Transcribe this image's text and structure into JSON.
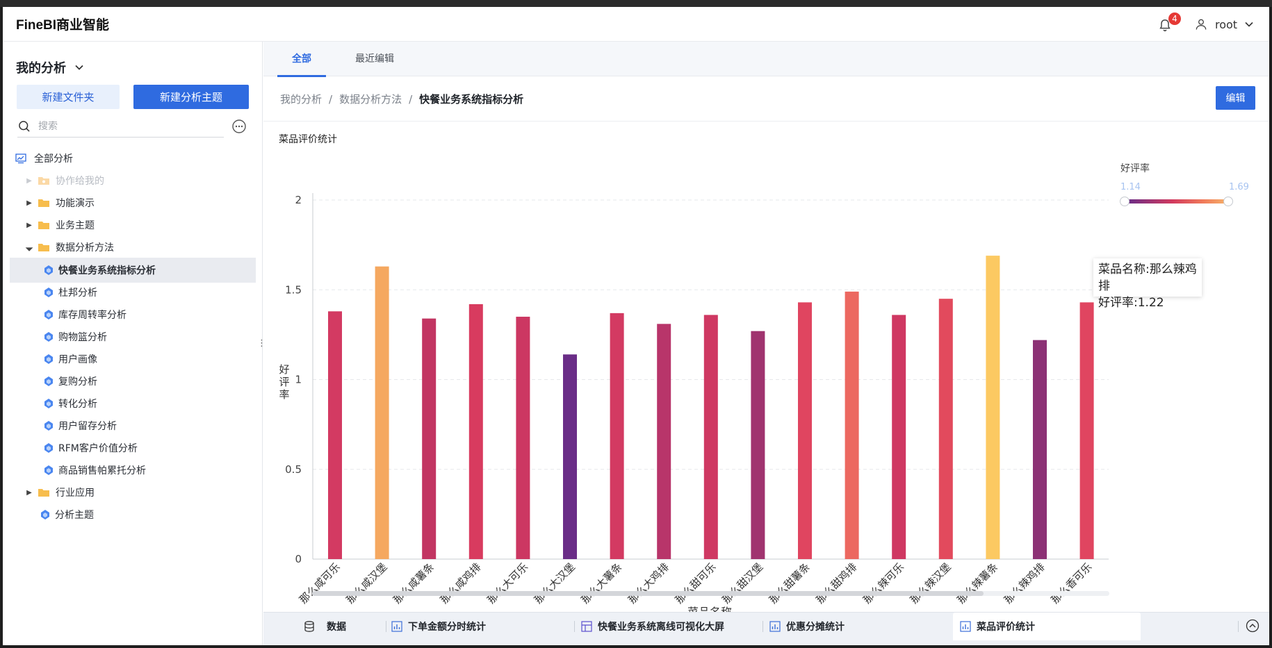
{
  "app": {
    "brand": "FineBI商业智能"
  },
  "header": {
    "notification_count": "4",
    "username": "root"
  },
  "sidebar": {
    "title": "我的分析",
    "new_folder": "新建文件夹",
    "new_theme": "新建分析主题",
    "search_placeholder": "搜索",
    "items": [
      {
        "label": "全部分析"
      },
      {
        "label": "协作给我的"
      },
      {
        "label": "功能演示"
      },
      {
        "label": "业务主题"
      },
      {
        "label": "数据分析方法"
      },
      {
        "label": "快餐业务系统指标分析"
      },
      {
        "label": "杜邦分析"
      },
      {
        "label": "库存周转率分析"
      },
      {
        "label": "购物篮分析"
      },
      {
        "label": "用户画像"
      },
      {
        "label": "复购分析"
      },
      {
        "label": "转化分析"
      },
      {
        "label": "用户留存分析"
      },
      {
        "label": "RFM客户价值分析"
      },
      {
        "label": "商品销售帕累托分析"
      },
      {
        "label": "行业应用"
      },
      {
        "label": "分析主题"
      }
    ]
  },
  "tabs": [
    {
      "label": "全部"
    },
    {
      "label": "最近编辑"
    }
  ],
  "breadcrumb": {
    "root": "我的分析",
    "sep": "/",
    "mid": "数据分析方法",
    "current": "快餐业务系统指标分析"
  },
  "toolbar": {
    "edit": "编辑"
  },
  "chart_title": "菜品评价统计",
  "legend": {
    "title": "好评率",
    "min": "1.14",
    "max": "1.69",
    "min_color": "#6a2d87",
    "max_color": "#f6b36a"
  },
  "tooltip": {
    "line1": "菜品名称:那么辣鸡排",
    "line2": "好评率:1.22"
  },
  "chart_data": {
    "type": "bar",
    "xlabel": "菜品名称",
    "ylabel": "好评率",
    "ylim": [
      0,
      2
    ],
    "yticks": [
      "0",
      "0.5",
      "1",
      "1.5",
      "2"
    ],
    "grid": true,
    "legend_placement": "top-right",
    "categories": [
      "那么咸可乐",
      "那么咸汉堡",
      "那么咸薯条",
      "那么咸鸡排",
      "那么大可乐",
      "那么大汉堡",
      "那么大薯条",
      "那么大鸡排",
      "那么甜可乐",
      "那么甜汉堡",
      "那么甜薯条",
      "那么甜鸡排",
      "那么辣可乐",
      "那么辣汉堡",
      "那么辣薯条",
      "那么辣鸡排",
      "那么香可乐"
    ],
    "values": [
      1.38,
      1.63,
      1.34,
      1.42,
      1.35,
      1.14,
      1.37,
      1.31,
      1.36,
      1.27,
      1.43,
      1.49,
      1.36,
      1.45,
      1.69,
      1.22,
      1.43
    ],
    "colors": [
      "#d33a62",
      "#f5a860",
      "#c23562",
      "#d83b5f",
      "#cc3762",
      "#6a2d87",
      "#d33a62",
      "#b8356a",
      "#cf3862",
      "#a0346f",
      "#e04560",
      "#ec6860",
      "#cf3862",
      "#e24a5d",
      "#fcc962",
      "#8c3175",
      "#e04560"
    ]
  },
  "bottom_tabs": [
    {
      "label": "数据"
    },
    {
      "label": "下单金额分时统计"
    },
    {
      "label": "快餐业务系统离线可视化大屏"
    },
    {
      "label": "优惠分摊统计"
    },
    {
      "label": "菜品评价统计"
    }
  ]
}
